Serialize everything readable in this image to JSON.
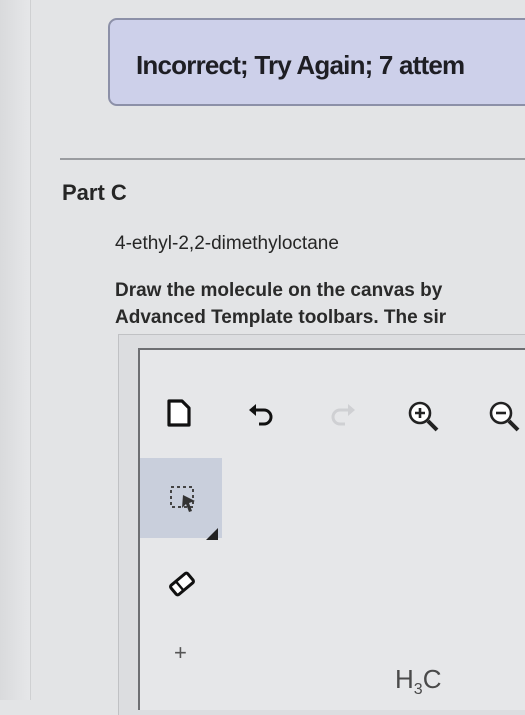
{
  "feedback": {
    "message": "Incorrect; Try Again; 7 attem"
  },
  "part": {
    "title": "Part C"
  },
  "question": {
    "compound": "4-ethyl-2,2-dimethyloctane",
    "instructions_line1": "Draw the molecule on the canvas by",
    "instructions_line2": "Advanced Template toolbars. The sir"
  },
  "toolbar": {
    "icons": [
      "new-document-icon",
      "undo-icon",
      "redo-icon",
      "zoom-in-icon",
      "zoom-out-icon"
    ]
  },
  "side_toolbar": {
    "icons": [
      "selection-icon",
      "eraser-icon"
    ],
    "plus_label": "+"
  },
  "canvas": {
    "label_main": "H",
    "label_sub": "3",
    "label_tail": "C"
  }
}
